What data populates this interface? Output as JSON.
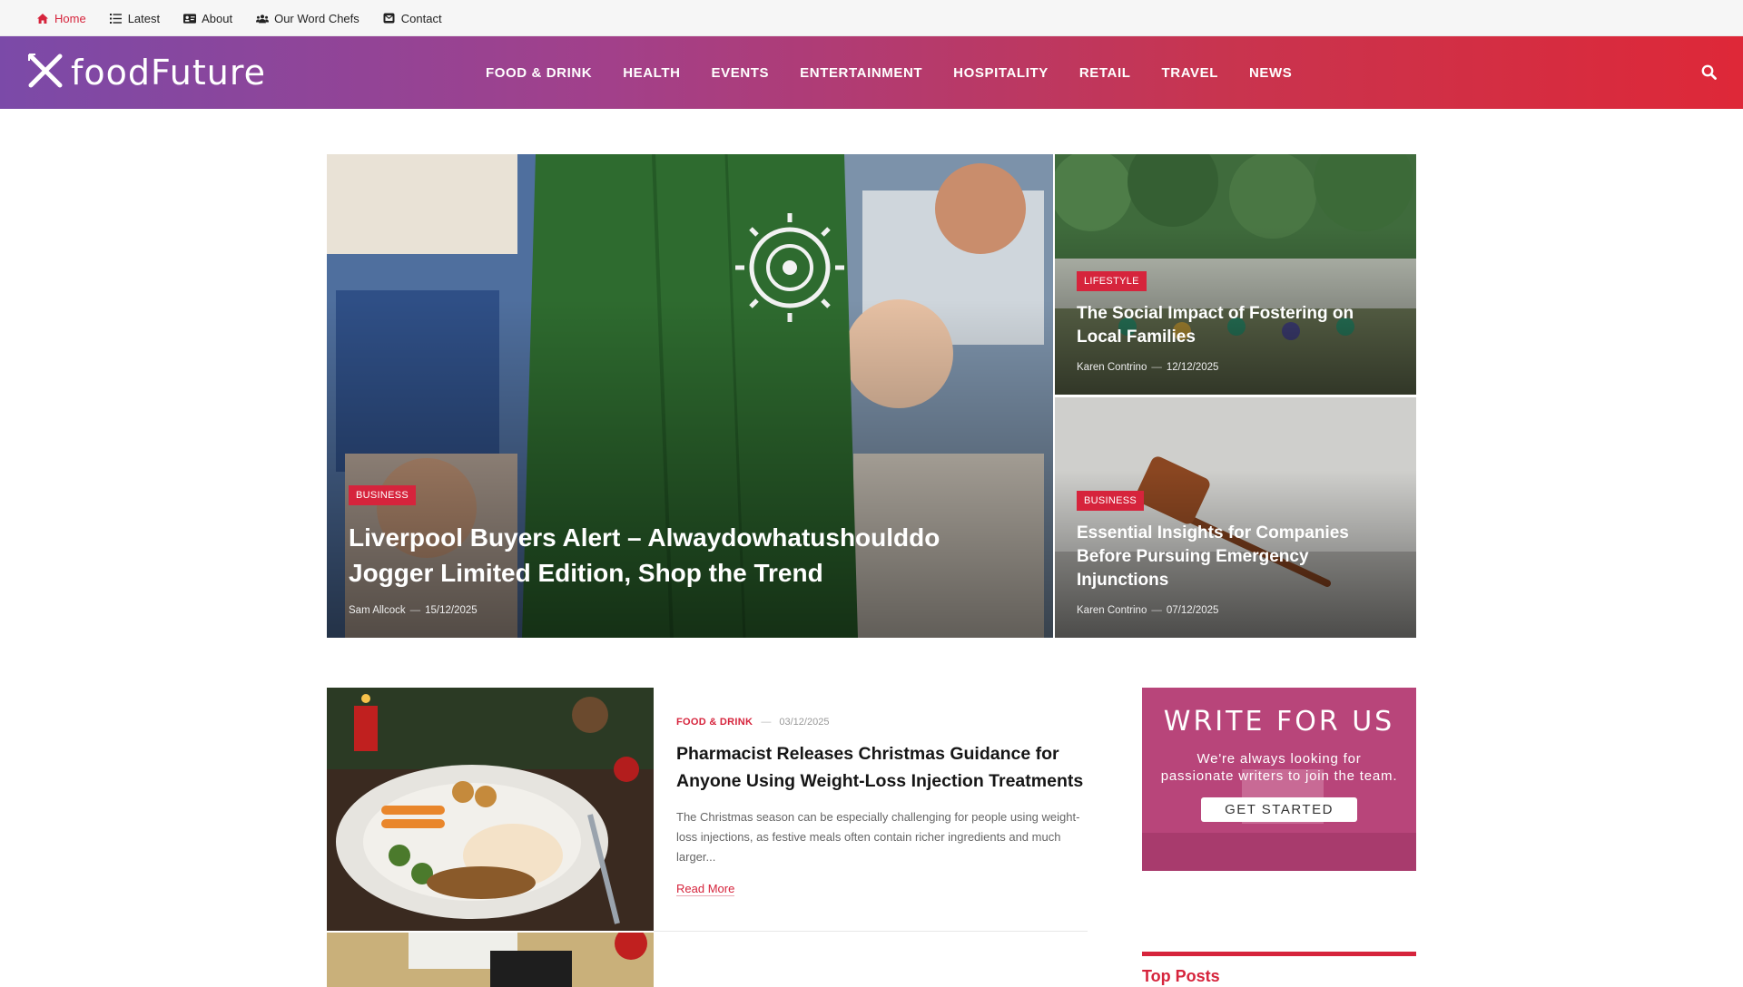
{
  "topbar": {
    "links": [
      {
        "label": "Home",
        "icon": "home-icon"
      },
      {
        "label": "Latest",
        "icon": "list-icon"
      },
      {
        "label": "About",
        "icon": "id-card-icon"
      },
      {
        "label": "Our Word Chefs",
        "icon": "users-icon"
      },
      {
        "label": "Contact",
        "icon": "envelope-icon"
      }
    ]
  },
  "header": {
    "logo_text": "foodFuture",
    "nav": [
      "FOOD & DRINK",
      "HEALTH",
      "EVENTS",
      "ENTERTAINMENT",
      "HOSPITALITY",
      "RETAIL",
      "TRAVEL",
      "NEWS"
    ]
  },
  "hero": {
    "main": {
      "category": "BUSINESS",
      "title": "Liverpool Buyers Alert – Alwaydowhatushoulddo Jogger Limited Edition, Shop the Trend",
      "author": "Sam Allcock",
      "date": "15/12/2025"
    },
    "side": [
      {
        "category": "LIFESTYLE",
        "title": "The Social Impact of Fostering on Local Families",
        "author": "Karen Contrino",
        "date": "12/12/2025"
      },
      {
        "category": "BUSINESS",
        "title": "Essential Insights for Companies Before Pursuing Emergency Injunctions",
        "author": "Karen Contrino",
        "date": "07/12/2025"
      }
    ]
  },
  "articles": [
    {
      "category": "FOOD & DRINK",
      "date": "03/12/2025",
      "title": "Pharmacist Releases Christmas Guidance for Anyone Using Weight-Loss Injection Treatments",
      "excerpt": "The Christmas season can be especially challenging for people using weight-loss injections, as festive meals often contain richer ingredients and much larger...",
      "read_more": "Read More"
    }
  ],
  "sidebar": {
    "promo": {
      "heading": "WRITE FOR US",
      "text": "We're always looking for passionate writers to join the team.",
      "button": "GET STARTED"
    },
    "top_posts_title": "Top Posts"
  },
  "colors": {
    "accent": "#d6243c",
    "header_gradient_start": "#7b4aa8",
    "header_gradient_end": "#de2838"
  }
}
